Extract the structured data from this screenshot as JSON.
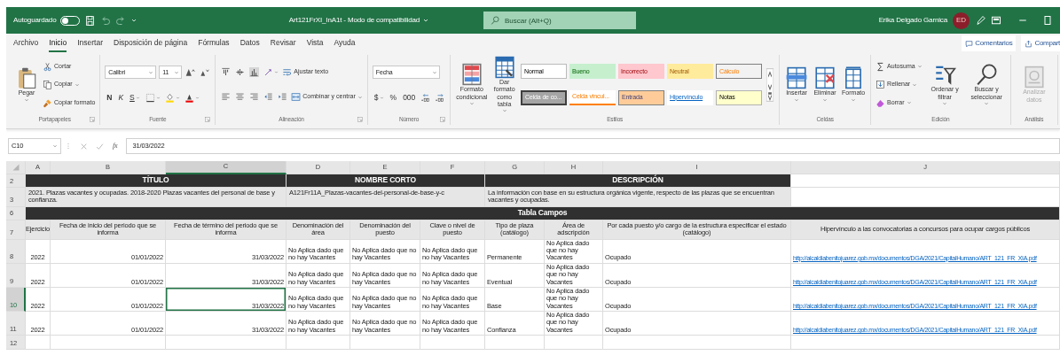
{
  "titlebar": {
    "autosave_label": "Autoguardado",
    "autosave_on": false,
    "title": "Art121FrXI_InA1t - Modo de compatibilidad",
    "search_placeholder": "Buscar (Alt+Q)",
    "user_name": "Erika Delgado Garnica",
    "user_initials": "ED"
  },
  "menu_tabs": [
    {
      "label": "Archivo",
      "selected": false
    },
    {
      "label": "Inicio",
      "selected": true
    },
    {
      "label": "Insertar",
      "selected": false
    },
    {
      "label": "Disposición de página",
      "selected": false
    },
    {
      "label": "Fórmulas",
      "selected": false
    },
    {
      "label": "Datos",
      "selected": false
    },
    {
      "label": "Revisar",
      "selected": false
    },
    {
      "label": "Vista",
      "selected": false
    },
    {
      "label": "Ayuda",
      "selected": false
    }
  ],
  "ribbon_actions": [
    "Comentarios",
    "Compart"
  ],
  "ribbon_groups": [
    {
      "label": "Portapapeles",
      "launcher": true,
      "columns": [
        [
          [
            {
              "kind": "big",
              "label": "Pegar",
              "dropdown": true
            }
          ]
        ],
        [
          [
            {
              "kind": "small",
              "label": "Cortar"
            }
          ],
          [
            {
              "kind": "small",
              "label": "Copiar",
              "dropdown": true
            }
          ],
          [
            {
              "kind": "small",
              "label": "Copiar formato"
            }
          ]
        ]
      ]
    },
    {
      "label": "Fuente",
      "launcher": true,
      "columns": [
        [
          [
            {
              "kind": "combo",
              "value": "Calibri"
            },
            {
              "kind": "combo",
              "value": "11"
            },
            {
              "kind": "icon"
            },
            {
              "kind": "icon"
            }
          ],
          [
            {
              "kind": "bold",
              "label": "N"
            },
            {
              "kind": "italic",
              "label": "K"
            },
            {
              "kind": "underline",
              "label": "S",
              "dropdown": true
            },
            {
              "kind": "icon",
              "dropdown": true
            },
            {
              "kind": "icon",
              "dropdown": true
            },
            {
              "kind": "icon",
              "dropdown": true
            }
          ]
        ]
      ]
    },
    {
      "label": "Alineación",
      "launcher": true,
      "columns": [
        [
          [
            {
              "kind": "icon"
            },
            {
              "kind": "icon"
            },
            {
              "kind": "icon"
            },
            {
              "kind": "icon",
              "dropdown": true
            },
            {
              "kind": "small",
              "label": "Ajustar texto"
            }
          ],
          [
            {
              "kind": "icon"
            },
            {
              "kind": "icon"
            },
            {
              "kind": "icon"
            },
            {
              "kind": "icon"
            },
            {
              "kind": "icon"
            },
            {
              "kind": "small",
              "label": "Combinar y centrar",
              "dropdown": true
            }
          ]
        ]
      ]
    },
    {
      "label": "Número",
      "launcher": true,
      "columns": [
        [
          [
            {
              "kind": "combo",
              "value": "Fecha"
            }
          ],
          [
            {
              "kind": "glyph",
              "label": "$",
              "dropdown": true
            },
            {
              "kind": "glyph",
              "label": "%"
            },
            {
              "kind": "glyph",
              "label": "000"
            },
            {
              "kind": "icon"
            },
            {
              "kind": "icon"
            }
          ]
        ]
      ]
    },
    {
      "label": "Estilos",
      "launcher": false,
      "columns": [
        [
          [
            {
              "kind": "big",
              "label": "Formato condicional",
              "dropdown": true
            }
          ]
        ],
        [
          [
            {
              "kind": "big",
              "label": "Dar formato como tabla",
              "dropdown": true
            }
          ]
        ],
        [
          [
            {
              "kind": "normal",
              "label": "Normal",
              "color": "#ffffff"
            },
            {
              "kind": "good",
              "label": "Bueno",
              "color": "#c6efce"
            },
            {
              "kind": "bad",
              "label": "Incorrecto",
              "color": "#ffc7ce"
            },
            {
              "kind": "neutral",
              "label": "Neutral",
              "color": "#ffeb9c"
            },
            {
              "kind": "calculation",
              "label": "Cálculo",
              "color": "#f2f2f2"
            }
          ],
          [
            {
              "kind": "check",
              "label": "Celda de co...",
              "color": "#a5a5a5"
            },
            {
              "kind": "linked",
              "label": "Celda vincul...",
              "color": "#ffffff"
            },
            {
              "kind": "input",
              "label": "Entrada",
              "color": "#ffcc99"
            },
            {
              "kind": "hyperlink",
              "label": "Hipervínculo",
              "color": "#ffffff"
            },
            {
              "kind": "note",
              "label": "Notas",
              "color": "#ffffcc"
            }
          ]
        ],
        [
          [
            {
              "kind": "scroller"
            }
          ]
        ]
      ]
    },
    {
      "label": "Celdas",
      "launcher": false,
      "columns": [
        [
          [
            {
              "kind": "big",
              "label": "Insertar",
              "dropdown": true
            }
          ]
        ],
        [
          [
            {
              "kind": "big",
              "label": "Eliminar",
              "dropdown": true
            }
          ]
        ],
        [
          [
            {
              "kind": "big",
              "label": "Formato",
              "dropdown": true
            }
          ]
        ]
      ]
    },
    {
      "label": "Edición",
      "launcher": false,
      "columns": [
        [
          [
            {
              "kind": "small",
              "label": "Autosuma",
              "dropdown": true
            }
          ],
          [
            {
              "kind": "small",
              "label": "Rellenar",
              "dropdown": true
            }
          ],
          [
            {
              "kind": "small",
              "label": "Borrar",
              "dropdown": true
            }
          ]
        ],
        [
          [
            {
              "kind": "big",
              "label": "Ordenar y filtrar",
              "dropdown": true
            }
          ]
        ],
        [
          [
            {
              "kind": "big",
              "label": "Buscar y seleccionar",
              "dropdown": true
            }
          ]
        ]
      ]
    },
    {
      "label": "Análisis",
      "launcher": false,
      "columns": [
        [
          [
            {
              "kind": "big",
              "label": "Analizar datos",
              "disabled": true
            }
          ]
        ]
      ]
    }
  ],
  "formula_bar": {
    "name_box": "C10",
    "function_label": "fx",
    "formula": "31/03/2022"
  },
  "sheet": {
    "columns": [
      {
        "letter": "A",
        "selected": false
      },
      {
        "letter": "B",
        "selected": false
      },
      {
        "letter": "C",
        "selected": true
      },
      {
        "letter": "D",
        "selected": false
      },
      {
        "letter": "E",
        "selected": false
      },
      {
        "letter": "F",
        "selected": false
      },
      {
        "letter": "G",
        "selected": false
      },
      {
        "letter": "H",
        "selected": false
      },
      {
        "letter": "I",
        "selected": false
      },
      {
        "letter": "J",
        "selected": false
      }
    ],
    "rows": [
      {
        "number": "2",
        "kind": "banner",
        "selected": false,
        "cells": [
          "TÍTULO",
          "NOMBRE CORTO",
          "DESCRIPCIÓN"
        ]
      },
      {
        "number": "3",
        "kind": "info",
        "selected": false,
        "cells": [
          "2021. Plazas vacantes y ocupadas. 2018-2020 Plazas vacantes del personal de base y confianza.",
          "A121Fr11A_Plazas-vacantes-del-personal-de-base-y-c",
          "La información con base en su estructura orgánica vigente, respecto de las plazas que se encuentran vacantes y ocupadas."
        ]
      },
      {
        "number": "6",
        "kind": "section",
        "selected": false,
        "cells": [
          "Tabla Campos"
        ]
      },
      {
        "number": "7",
        "kind": "header",
        "selected": false,
        "cells": [
          "Ejercicio",
          "Fecha de inicio del periodo que se informa",
          "Fecha de término del periodo que se informa",
          "Denominación del área",
          "Denominación del puesto",
          "Clave o nivel de puesto",
          "Tipo de plaza (catálogo)",
          "Área de adscripción",
          "Por cada puesto y/o cargo de la estructura especificar el estado (catálogo)",
          "Hipervínculo a las convocatorias a concursos para ocupar cargos públicos"
        ]
      },
      {
        "number": "8",
        "kind": "data",
        "selected": false,
        "cells": [
          {
            "text": "2022",
            "selected": false
          },
          {
            "text": "01/01/2022",
            "selected": false
          },
          {
            "text": "31/03/2022",
            "selected": false
          },
          {
            "text": "No Aplica dado que no hay Vacantes",
            "selected": false
          },
          {
            "text": "No Aplica dado que no hay Vacantes",
            "selected": false
          },
          {
            "text": "No Aplica dado que no hay Vacantes",
            "selected": false
          },
          {
            "text": "Permanente",
            "selected": false
          },
          {
            "text": "No Aplica dado que no hay Vacantes",
            "selected": false
          },
          {
            "text": "Ocupado",
            "selected": false
          },
          {
            "text": "http://alcaldiabenitojuarez.gob.mx/documentos/DGA/2021/CapitalHumano/ART_121_FR_XIA.pdf",
            "selected": false,
            "kind": "link"
          }
        ]
      },
      {
        "number": "9",
        "kind": "data",
        "selected": false,
        "cells": [
          {
            "text": "2022",
            "selected": false
          },
          {
            "text": "01/01/2022",
            "selected": false
          },
          {
            "text": "31/03/2022",
            "selected": false
          },
          {
            "text": "No Aplica dado que no hay Vacantes",
            "selected": false
          },
          {
            "text": "No Aplica dado que no hay Vacantes",
            "selected": false
          },
          {
            "text": "No Aplica dado que no hay Vacantes",
            "selected": false
          },
          {
            "text": "Eventual",
            "selected": false
          },
          {
            "text": "No Aplica dado que no hay Vacantes",
            "selected": false
          },
          {
            "text": "Ocupado",
            "selected": false
          },
          {
            "text": "http://alcaldiabenitojuarez.gob.mx/documentos/DGA/2021/CapitalHumano/ART_121_FR_XIA.pdf",
            "selected": false,
            "kind": "link"
          }
        ]
      },
      {
        "number": "10",
        "kind": "data",
        "selected": true,
        "cells": [
          {
            "text": "2022",
            "selected": false
          },
          {
            "text": "01/01/2022",
            "selected": false
          },
          {
            "text": "31/03/2022",
            "selected": true
          },
          {
            "text": "No Aplica dado que no hay Vacantes",
            "selected": false
          },
          {
            "text": "No Aplica dado que no hay Vacantes",
            "selected": false
          },
          {
            "text": "No Aplica dado que no hay Vacantes",
            "selected": false
          },
          {
            "text": "Base",
            "selected": false
          },
          {
            "text": "No Aplica dado que no hay Vacantes",
            "selected": false
          },
          {
            "text": "Ocupado",
            "selected": false
          },
          {
            "text": "http://alcaldiabenitojuarez.gob.mx/documentos/DGA/2021/CapitalHumano/ART_121_FR_XIA.pdf",
            "selected": false,
            "kind": "link"
          }
        ]
      },
      {
        "number": "11",
        "kind": "data",
        "selected": false,
        "cells": [
          {
            "text": "2022",
            "selected": false
          },
          {
            "text": "01/01/2022",
            "selected": false
          },
          {
            "text": "31/03/2022",
            "selected": false
          },
          {
            "text": "No Aplica dado que no hay Vacantes",
            "selected": false
          },
          {
            "text": "No Aplica dado que no hay Vacantes",
            "selected": false
          },
          {
            "text": "No Aplica dado que no hay Vacantes",
            "selected": false
          },
          {
            "text": "Confianza",
            "selected": false
          },
          {
            "text": "No Aplica dado que no hay Vacantes",
            "selected": false
          },
          {
            "text": "Ocupado",
            "selected": false
          },
          {
            "text": "http://alcaldiabenitojuarez.gob.mx/documentos/DGA/2021/CapitalHumano/ART_121_FR_XIA.pdf",
            "selected": false,
            "kind": "link"
          }
        ]
      },
      {
        "number": "12",
        "kind": "empty",
        "selected": false
      }
    ]
  }
}
